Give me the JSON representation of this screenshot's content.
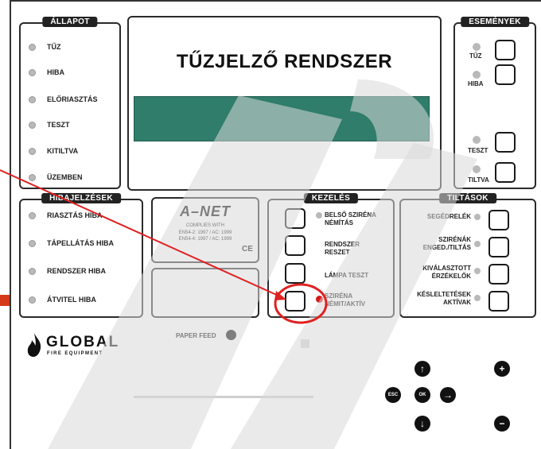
{
  "title": "TŰZJELZŐ RENDSZER",
  "allapot": {
    "header": "ÁLLAPOT",
    "items": [
      "TŰZ",
      "HIBA",
      "ELŐRIASZTÁS",
      "TESZT",
      "KITILTVA",
      "ÜZEMBEN"
    ]
  },
  "esemenyek": {
    "header": "ESEMÉNYEK",
    "items": [
      "TŰZ",
      "HIBA",
      "TESZT",
      "TILTVA"
    ]
  },
  "hibajelzesek": {
    "header": "HIBAJELZÉSEK",
    "items": [
      "RIASZTÁS HIBA",
      "TÁPELLÁTÁS HIBA",
      "RENDSZER HIBA",
      "ÁTVITEL HIBA"
    ]
  },
  "anet": {
    "logo": "A–NET",
    "line1": "COMPLIES WITH",
    "line2": "EN54-2: 1997 / AC: 1999",
    "line3": "EN54-4: 1997 / AC: 1999",
    "mark": "CE"
  },
  "kezeles": {
    "header": "KEZELÉS",
    "items": [
      "BELSŐ SZIRÉNA NÉMÍTÁS",
      "RENDSZER RESZET",
      "LÁMPA TESZT",
      "SZIRÉNA NÉMIT/AKTÍV"
    ]
  },
  "tiltasok": {
    "header": "TILTÁSOK",
    "items": [
      "SEGÉDRELÉK",
      "SZIRÉNÁK ENGED./TILTÁS",
      "KIVÁLASZTOTT ÉRZÉKELŐK",
      "KÉSLELTETÉSEK AKTÍVAK"
    ]
  },
  "brand": {
    "name": "GLOBAL",
    "tagline": "FIRE EQUIPMENT"
  },
  "paper_feed": "PAPER FEED",
  "keypad": {
    "up": "↑",
    "down": "↓",
    "right": "→",
    "esc": "ESC",
    "ok": "OK",
    "plus": "+",
    "minus": "−"
  },
  "colors": {
    "display": "#2f7d6a",
    "annotation": "#e02020",
    "led_active": "#d61a1a"
  }
}
